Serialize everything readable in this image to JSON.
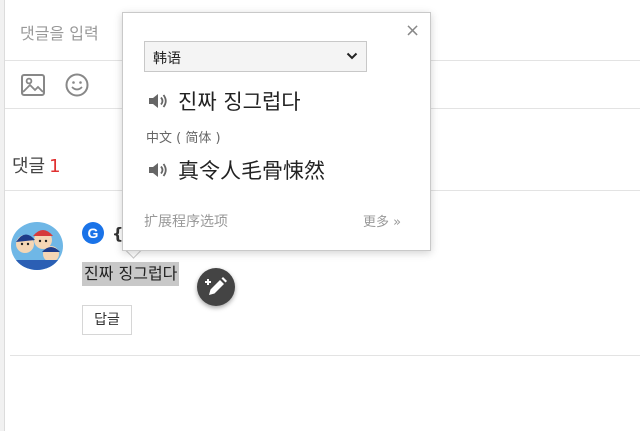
{
  "comment_form": {
    "input_placeholder": "댓글을 입력",
    "toolbar": {
      "image_icon": "image-icon",
      "emoji_icon": "smiley-icon"
    }
  },
  "comments_header": {
    "label": "댓글",
    "count": "1"
  },
  "comment": {
    "provider_icon": "google-icon",
    "provider_letter": "G",
    "author_partial": "{",
    "text": "진짜 징그럽다",
    "reply_label": "답글",
    "edit_icon": "pencil-plus-icon"
  },
  "translate_popup": {
    "close": "×",
    "language_selected": "韩语",
    "source_text": "진짜 징그럽다",
    "target_language": "中文 ( 简体 )",
    "translated_text": "真令人毛骨悚然",
    "options_link": "扩展程序选项",
    "more_link": "更多 »"
  },
  "colors": {
    "count_accent": "#e03131",
    "google_blue": "#1a73e8",
    "selection": "#c8c8c8"
  }
}
